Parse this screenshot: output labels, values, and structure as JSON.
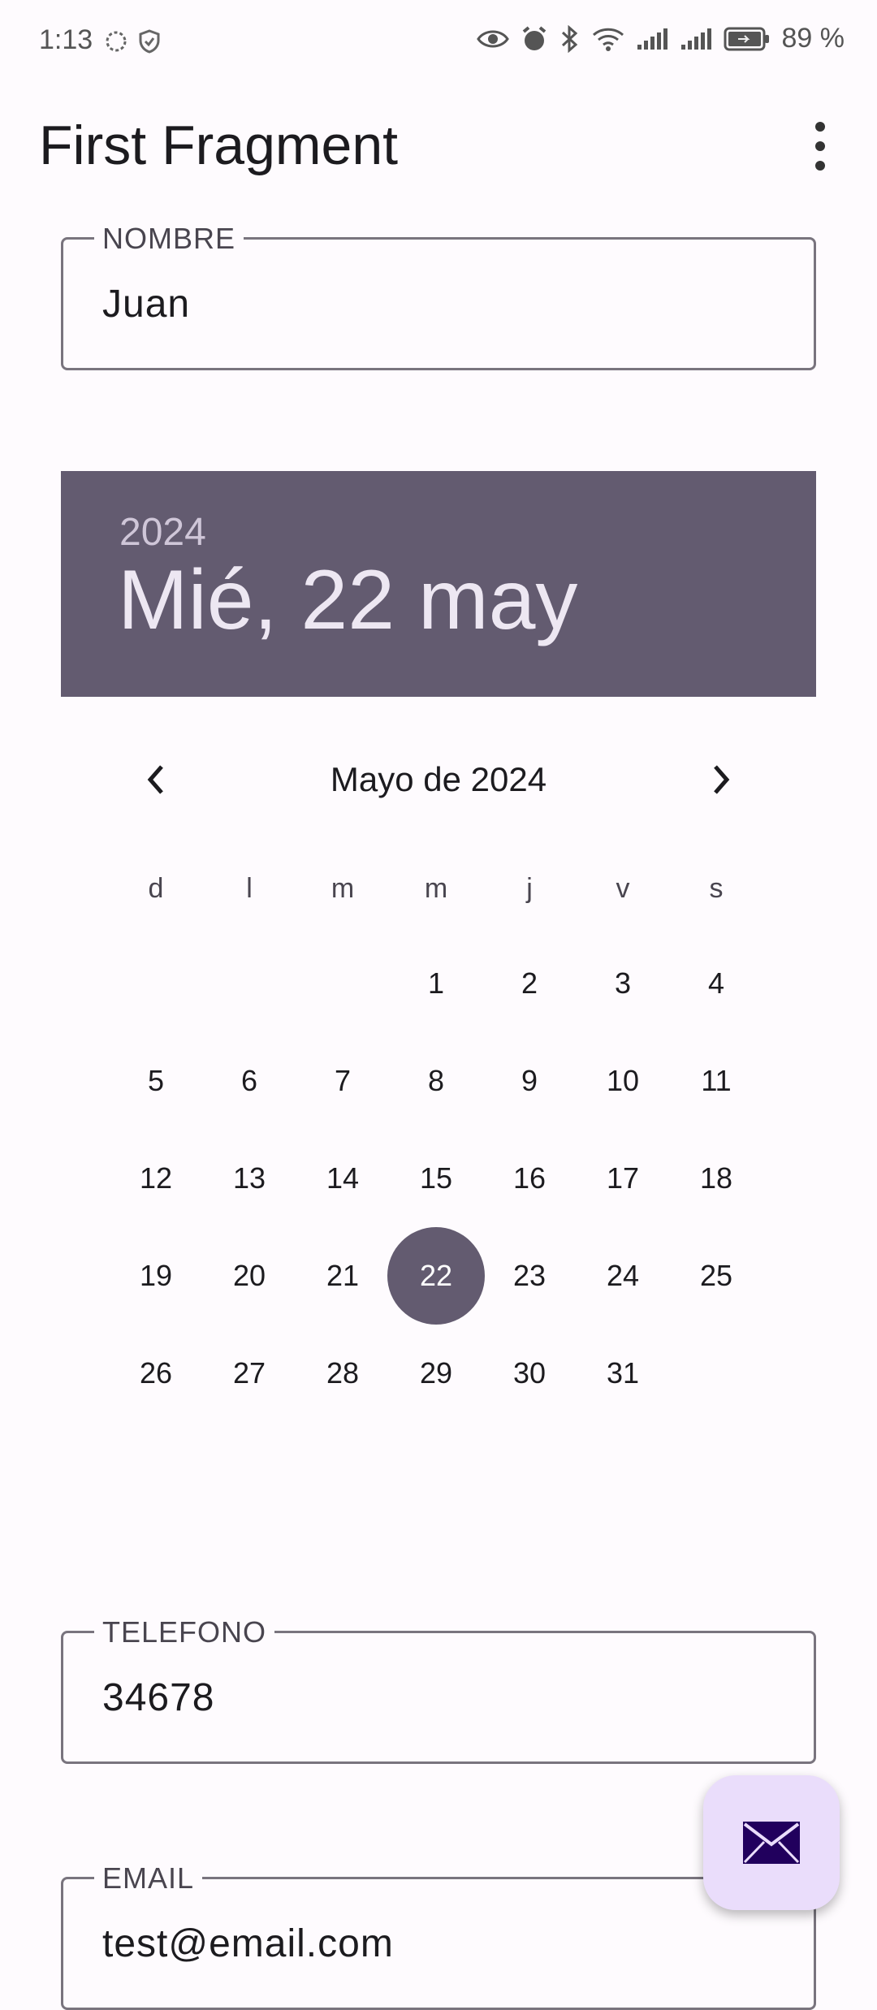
{
  "status_bar": {
    "time": "1:13",
    "battery_text": "89 %"
  },
  "app_bar": {
    "title": "First Fragment"
  },
  "fields": {
    "nombre": {
      "label": "NOMBRE",
      "value": "Juan"
    },
    "telefono": {
      "label": "TELEFONO",
      "value": "34678"
    },
    "email": {
      "label": "EMAIL",
      "value": "test@email.com"
    }
  },
  "date_picker": {
    "year": "2024",
    "selected_date_text": "Mié, 22 may",
    "month_label": "Mayo de 2024",
    "weekdays": [
      "d",
      "l",
      "m",
      "m",
      "j",
      "v",
      "s"
    ],
    "days": [
      "1",
      "2",
      "3",
      "4",
      "5",
      "6",
      "7",
      "8",
      "9",
      "10",
      "11",
      "12",
      "13",
      "14",
      "15",
      "16",
      "17",
      "18",
      "19",
      "20",
      "21",
      "22",
      "23",
      "24",
      "25",
      "26",
      "27",
      "28",
      "29",
      "30",
      "31"
    ],
    "selected_day": "22",
    "accent_color": "#635b70"
  },
  "icons": {
    "overflow": "more-vert-icon",
    "prev": "chevron-left-icon",
    "next": "chevron-right-icon",
    "fab": "email-icon"
  },
  "colors": {
    "fab_background": "#eaddfb",
    "fab_icon": "#21005d"
  }
}
